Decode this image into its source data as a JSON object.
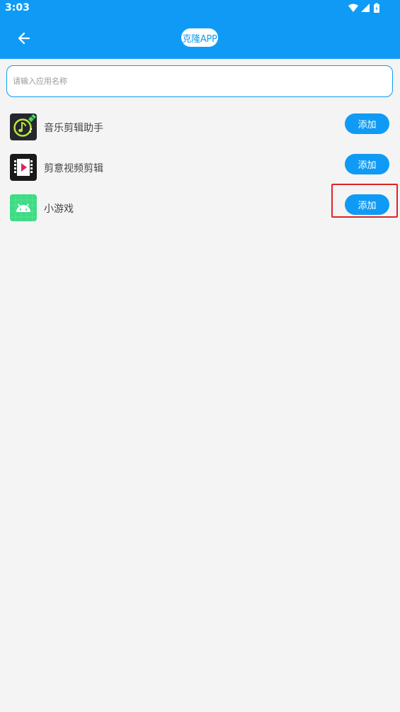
{
  "status_bar": {
    "time": "3:03"
  },
  "header": {
    "title": "克隆APP"
  },
  "search": {
    "placeholder": "请输入应用名称",
    "value": ""
  },
  "apps": [
    {
      "name": "音乐剪辑助手",
      "button_label": "添加"
    },
    {
      "name": "剪意视频剪辑",
      "button_label": "添加"
    },
    {
      "name": "小游戏",
      "button_label": "添加"
    }
  ],
  "icons": {
    "back": "arrow-left-icon",
    "wifi": "wifi-icon",
    "signal": "signal-icon",
    "battery": "battery-icon"
  },
  "colors": {
    "primary": "#0f9bf5",
    "background": "#f4f4f4",
    "highlight": "#e02424"
  }
}
